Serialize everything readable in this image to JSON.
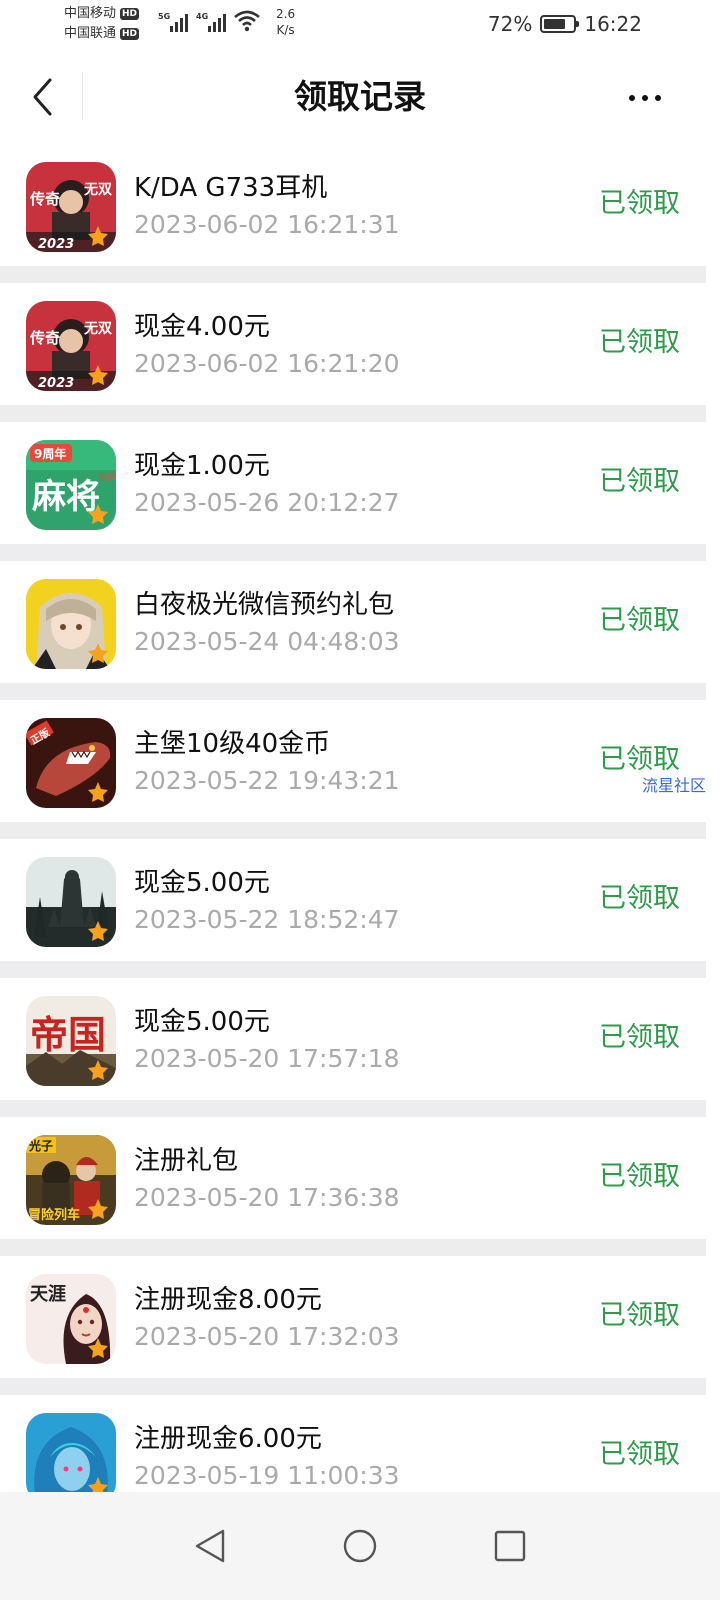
{
  "status_bar": {
    "carrier1": "中国移动",
    "carrier2": "中国联通",
    "hd": "HD",
    "net1": "5G",
    "net2": "4G",
    "speed_value": "2.6",
    "speed_unit": "K/s",
    "battery": "72%",
    "time": "16:22",
    "battery_level": 0.72
  },
  "header": {
    "title": "领取记录",
    "back_icon": "chevron-left-icon",
    "more_icon": "more-dots-icon"
  },
  "records": [
    {
      "title": "K/DA G733耳机",
      "time": "2023-06-02 16:21:31",
      "status": "已领取",
      "icon": "game-icon-chuanqi",
      "icon_text_top": "传奇",
      "icon_text_right": "无双",
      "icon_text_bottom": "2023"
    },
    {
      "title": "现金4.00元",
      "time": "2023-06-02 16:21:20",
      "status": "已领取",
      "icon": "game-icon-chuanqi",
      "icon_text_top": "传奇",
      "icon_text_right": "无双",
      "icon_text_bottom": "2023"
    },
    {
      "title": "现金1.00元",
      "time": "2023-05-26 20:12:27",
      "status": "已领取",
      "icon": "game-icon-mahjong",
      "icon_text_top": "9周年",
      "icon_text_right": "欢乐",
      "icon_text_bottom": "麻将"
    },
    {
      "title": "白夜极光微信预约礼包",
      "time": "2023-05-24 04:48:03",
      "status": "已领取",
      "icon": "game-icon-aurora"
    },
    {
      "title": "主堡10级40金币",
      "time": "2023-05-22 19:43:21",
      "status": "已领取",
      "icon": "game-icon-shark",
      "icon_text_top": "正版",
      "watermark": "流星社区"
    },
    {
      "title": "现金5.00元",
      "time": "2023-05-22 18:52:47",
      "status": "已领取",
      "icon": "game-icon-forest"
    },
    {
      "title": "现金5.00元",
      "time": "2023-05-20 17:57:18",
      "status": "已领取",
      "icon": "game-icon-empire",
      "icon_text_bottom": "帝国"
    },
    {
      "title": "注册礼包",
      "time": "2023-05-20 17:36:38",
      "status": "已领取",
      "icon": "game-icon-train",
      "icon_text_top": "光子",
      "icon_text_bottom": "冒险列车"
    },
    {
      "title": "注册现金8.00元",
      "time": "2023-05-20 17:32:03",
      "status": "已领取",
      "icon": "game-icon-tianya",
      "icon_text_top": "天涯"
    },
    {
      "title": "注册现金6.00元",
      "time": "2023-05-19 11:00:33",
      "status": "已领取",
      "icon": "game-icon-heroine"
    }
  ],
  "nav_bar": {
    "back": "nav-back-icon",
    "home": "nav-home-icon",
    "recents": "nav-recents-icon"
  },
  "colors": {
    "status_green": "#2e9b4b",
    "time_gray": "#aaaaaa",
    "separator": "#ededf0"
  }
}
